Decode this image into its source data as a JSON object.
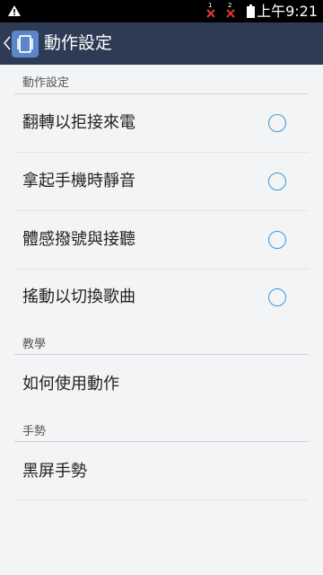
{
  "status_bar": {
    "time": "上午9:21",
    "sim1_label": "1",
    "sim2_label": "2"
  },
  "app_bar": {
    "title": "動作設定"
  },
  "sections": [
    {
      "header": "動作設定",
      "items": [
        {
          "label": "翻轉以拒接來電",
          "checked": false
        },
        {
          "label": "拿起手機時靜音",
          "checked": false
        },
        {
          "label": "體感撥號與接聽",
          "checked": false
        },
        {
          "label": "搖動以切換歌曲",
          "checked": false
        }
      ]
    },
    {
      "header": "教學",
      "items": [
        {
          "label": "如何使用動作"
        }
      ]
    },
    {
      "header": "手勢",
      "items": [
        {
          "label": "黑屏手勢"
        }
      ]
    }
  ],
  "colors": {
    "app_bar": "#2f3b55",
    "status_bar": "#000000",
    "accent": "#3c97d6",
    "background": "#f3f4f6"
  }
}
